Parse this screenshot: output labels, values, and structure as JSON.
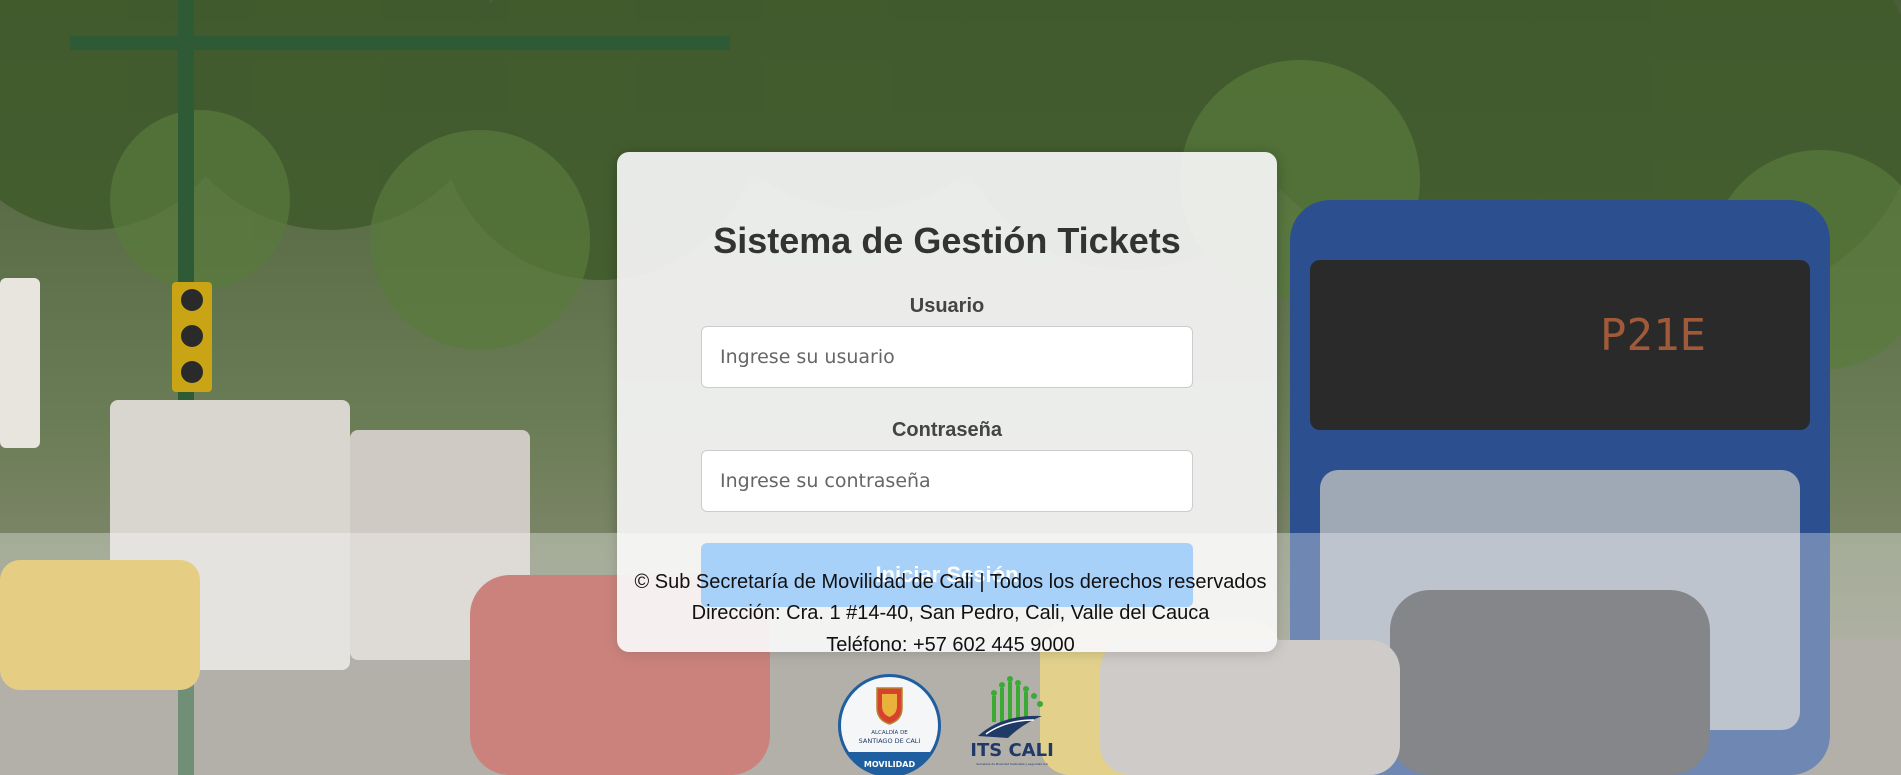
{
  "login": {
    "title": "Sistema de Gestión Tickets",
    "user_label": "Usuario",
    "user_placeholder": "Ingrese su usuario",
    "user_value": "",
    "password_label": "Contraseña",
    "password_placeholder": "Ingrese su contraseña",
    "password_value": "",
    "submit_label": "Iniciar Sesión"
  },
  "footer": {
    "copyright": "© Sub Secretaría de Movilidad de Cali | Todos los derechos reservados",
    "address": "Dirección: Cra. 1 #14-40, San Pedro, Cali, Valle del Cauca",
    "phone": "Teléfono: +57 602 445 9000"
  },
  "logos": {
    "alcaldia": {
      "line1": "ALCALDÍA DE",
      "line2": "SANTIAGO DE CALI",
      "band": "MOVILIDAD"
    },
    "its": {
      "name": "ITS CALI",
      "tagline": "Secretaría de Movilidad Sostenible y seguridad vial"
    }
  },
  "colors": {
    "button": "#7fbcf8",
    "card": "#f5f5f5",
    "logo_blue": "#1f5fa0",
    "logo_green": "#3aa935"
  }
}
